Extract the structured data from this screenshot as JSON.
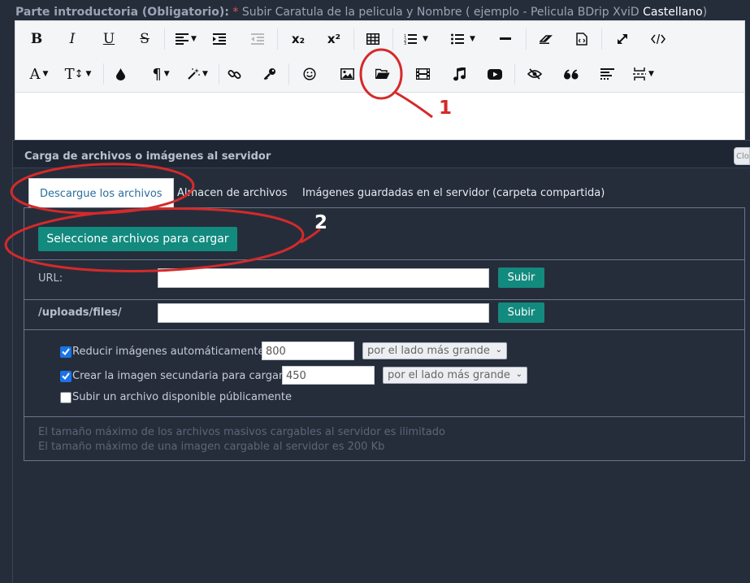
{
  "top_label": {
    "bold_text": "Parte introductoria (Obligatorio):",
    "asterisk": "*",
    "text": " Subir Caratula de la pelicula y Nombre ( ejemplo - Pelicula BDrip XviD ",
    "highlight": "Castellano",
    "text_end": ")"
  },
  "toolbar": {
    "bold": "B",
    "italic": "I",
    "underline": "U",
    "strike": "S",
    "subscript": "x₂",
    "superscript": "x²",
    "font_color": "A",
    "font_size": "T",
    "paragraph": "¶"
  },
  "panel": {
    "title": "Carga de archivos o imágenes al servidor",
    "close_label": "Clo"
  },
  "tabs": [
    {
      "label": "Descargue los archivos",
      "active": true
    },
    {
      "label": "Almacen de archivos",
      "active": false
    },
    {
      "label": "Imágenes guardadas en el servidor (carpeta compartida)",
      "active": false
    }
  ],
  "select_files_button": "Seleccione archivos para cargar",
  "url_row": {
    "label": "URL:",
    "value": "",
    "button": "Subir"
  },
  "path_row": {
    "label": "/uploads/files/",
    "value": "",
    "button": "Subir"
  },
  "options": [
    {
      "label": "Reducir imágenes automáticamente",
      "checked": true,
      "value": "800",
      "select": "por el lado más grande"
    },
    {
      "label": "Crear la imagen secundaria para cargar",
      "checked": true,
      "value": "450",
      "select": "por el lado más grande"
    },
    {
      "label": "Subir un archivo disponible públicamente",
      "checked": false
    }
  ],
  "info": [
    "El tamaño máximo de los archivos masivos cargables al servidor es ilimitado",
    "El tamaño máximo de una imagen cargable al servidor es 200 Kb"
  ],
  "annotations": {
    "number_1": "1",
    "number_2": "2",
    "color": "#d42a2a"
  },
  "colors": {
    "background": "#252d3b",
    "accent_button": "#138a7e",
    "active_tab_text": "#2a6e9c"
  }
}
